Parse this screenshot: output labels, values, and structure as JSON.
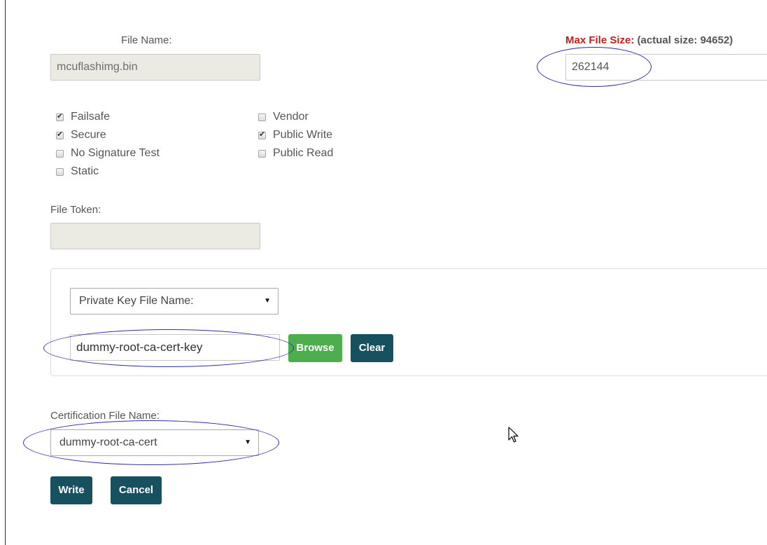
{
  "file_name": {
    "label": "File Name:",
    "value": "mcuflashimg.bin"
  },
  "max_file_size": {
    "label": "Max File Size:",
    "actual": "(actual size: 94652)",
    "value": "262144",
    "label_color": "#c0211f"
  },
  "flags": {
    "failsafe": {
      "label": "Failsafe",
      "checked": true
    },
    "secure": {
      "label": "Secure",
      "checked": true
    },
    "no_signature_test": {
      "label": "No Signature Test",
      "checked": false
    },
    "static": {
      "label": "Static",
      "checked": false
    },
    "vendor": {
      "label": "Vendor",
      "checked": false
    },
    "public_write": {
      "label": "Public Write",
      "checked": true
    },
    "public_read": {
      "label": "Public Read",
      "checked": false
    }
  },
  "file_token": {
    "label": "File Token:",
    "value": ""
  },
  "private_key": {
    "select_label": "Private Key File Name:",
    "value": "dummy-root-ca-cert-key",
    "browse_label": "Browse",
    "clear_label": "Clear"
  },
  "certification": {
    "label": "Certification File Name:",
    "value": "dummy-root-ca-cert"
  },
  "actions": {
    "write_label": "Write",
    "cancel_label": "Cancel"
  },
  "colors": {
    "teal_button": "#17505f",
    "green_button": "#4cae4c",
    "annotation_ellipse": "#2e2ea8"
  }
}
